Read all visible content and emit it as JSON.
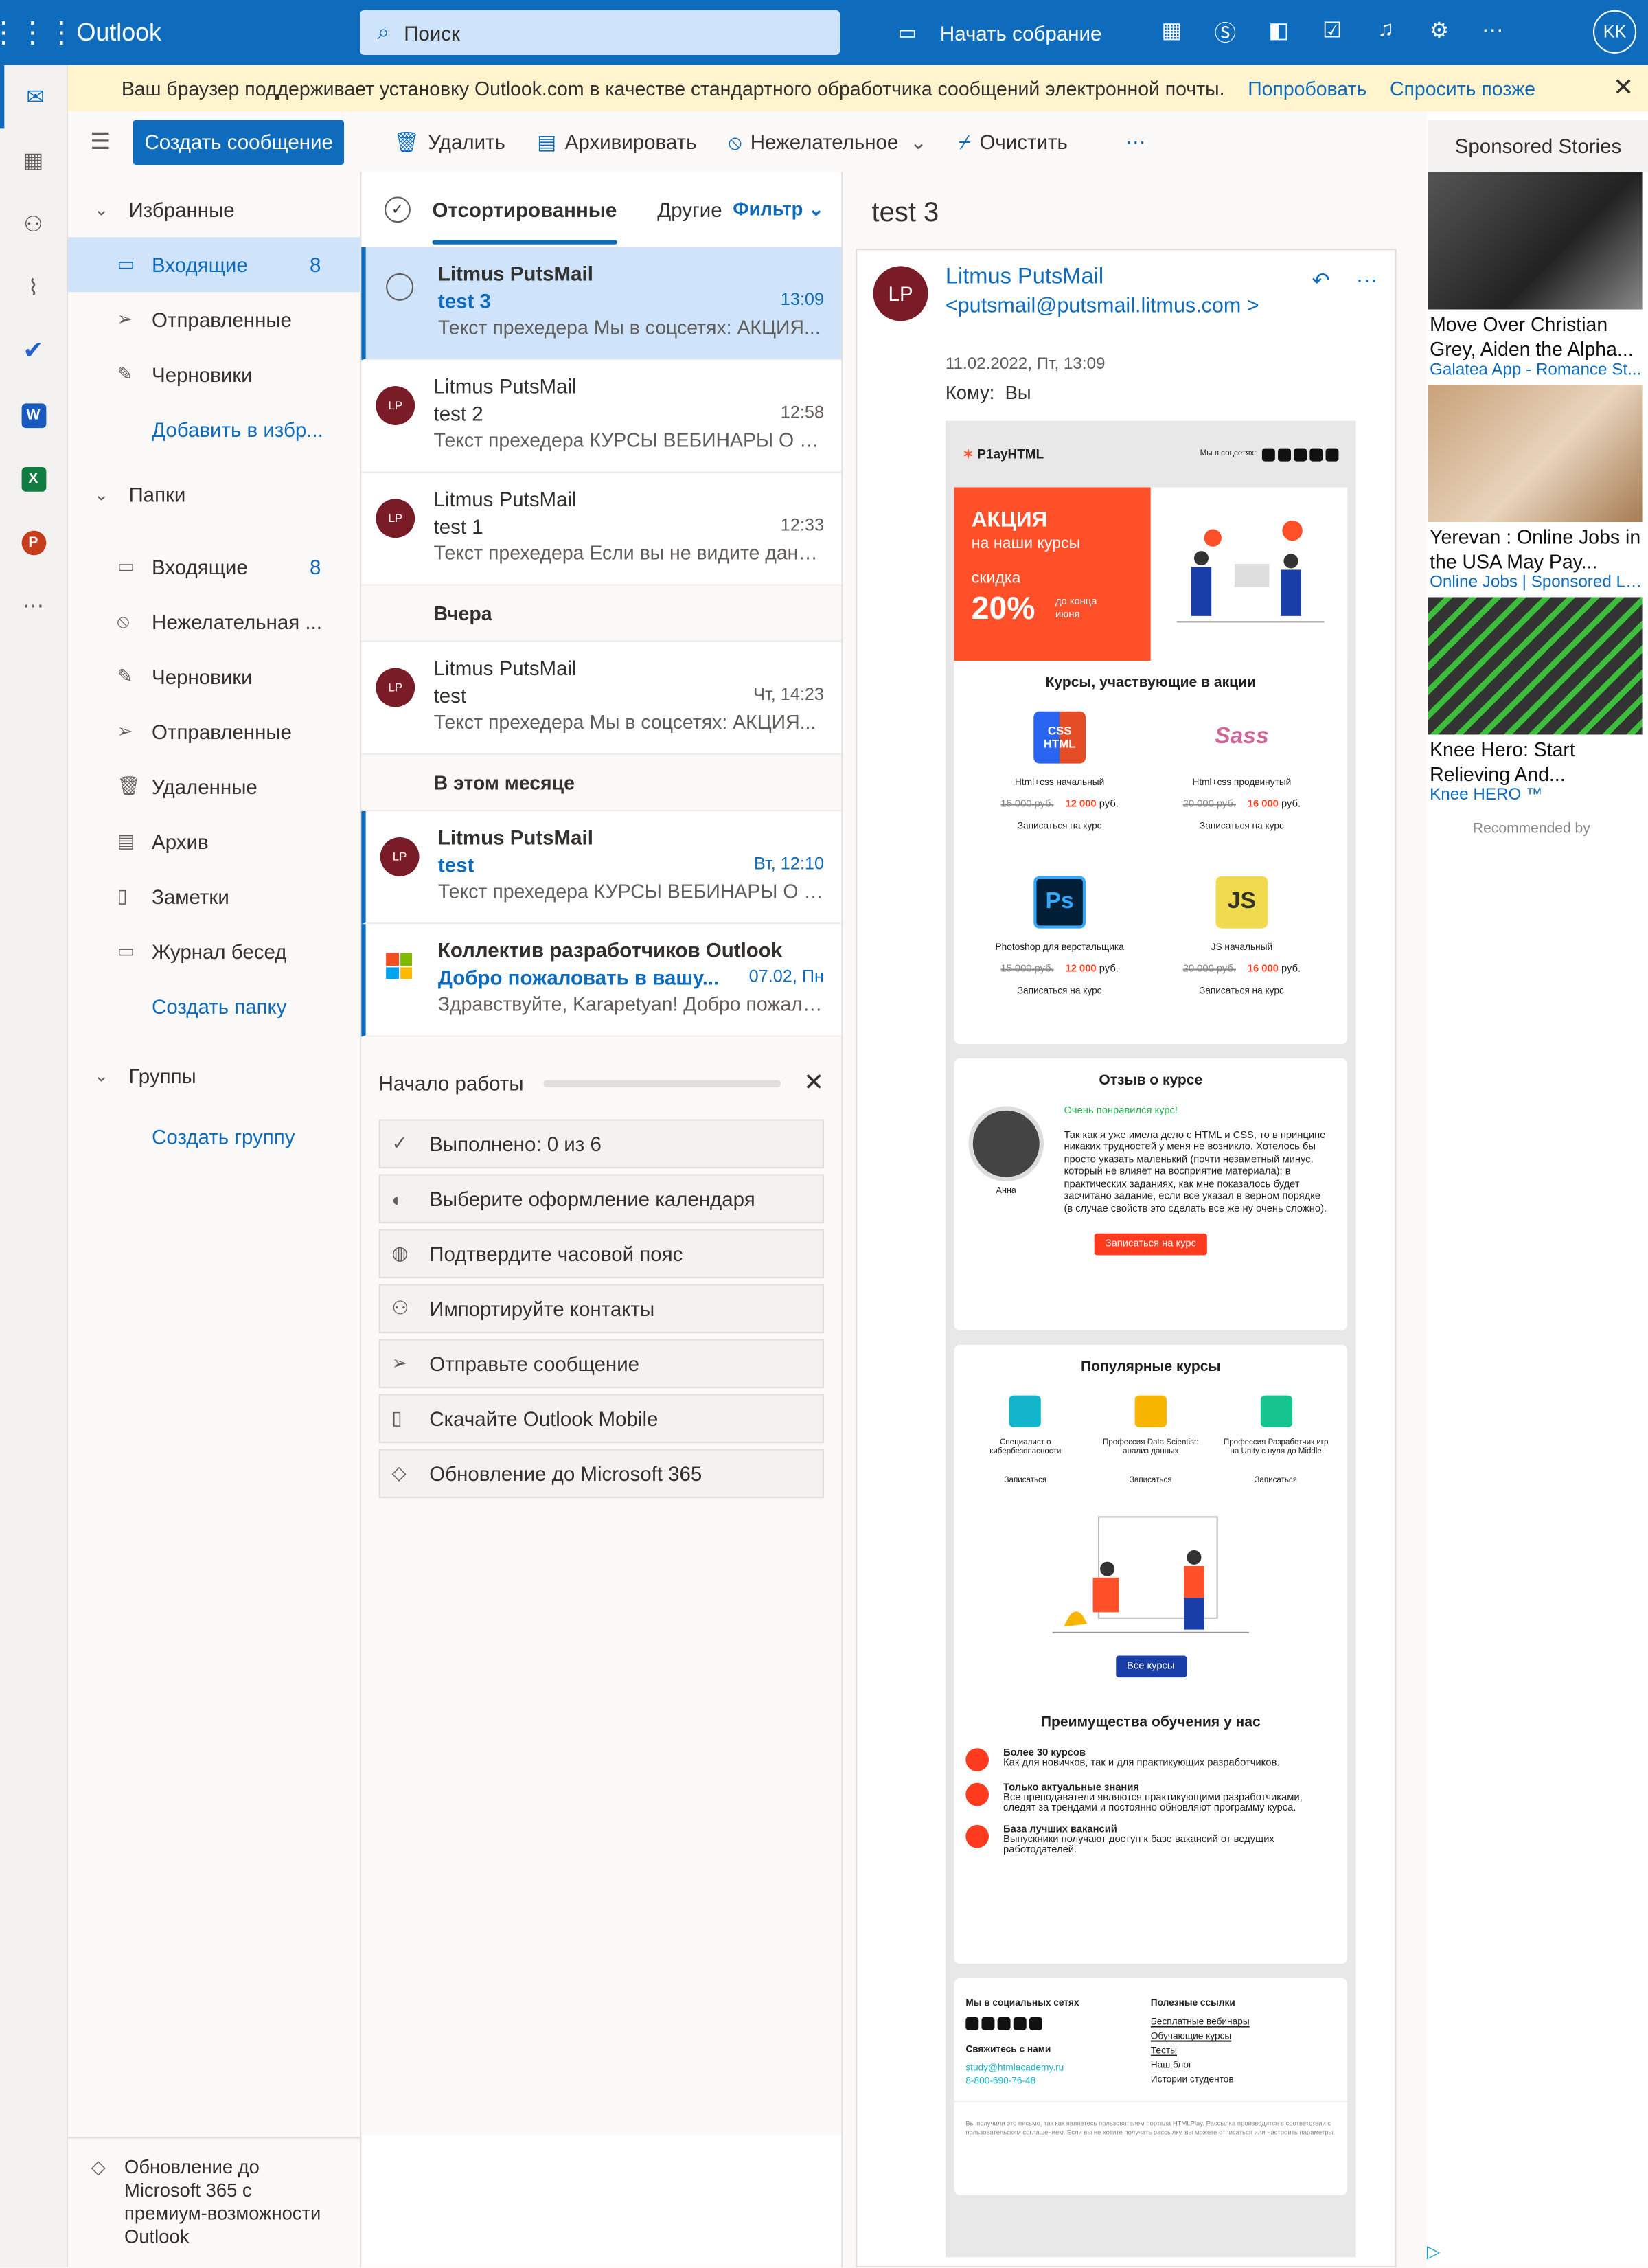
{
  "topbar": {
    "app": "Outlook",
    "search_placeholder": "Поиск",
    "meet": "Начать собрание",
    "user_initials": "KK"
  },
  "banner": {
    "text": "Ваш браузер поддерживает установку Outlook.com в качестве стандартного обработчика сообщений электронной почты.",
    "try": "Попробовать",
    "later": "Спросить позже"
  },
  "commands": {
    "new": "Создать сообщение",
    "delete": "Удалить",
    "archive": "Архивировать",
    "junk": "Нежелательное",
    "sweep": "Очистить"
  },
  "nav": {
    "favorites": "Избранные",
    "fav_items": [
      {
        "label": "Входящие",
        "count": "8"
      },
      {
        "label": "Отправленные",
        "count": ""
      },
      {
        "label": "Черновики",
        "count": ""
      }
    ],
    "add_fav": "Добавить в избр...",
    "folders": "Папки",
    "folder_items": [
      {
        "label": "Входящие",
        "count": "8"
      },
      {
        "label": "Нежелательная ...",
        "count": ""
      },
      {
        "label": "Черновики",
        "count": ""
      },
      {
        "label": "Отправленные",
        "count": ""
      },
      {
        "label": "Удаленные",
        "count": ""
      },
      {
        "label": "Архив",
        "count": ""
      },
      {
        "label": "Заметки",
        "count": ""
      },
      {
        "label": "Журнал бесед",
        "count": ""
      }
    ],
    "create_folder": "Создать папку",
    "groups": "Группы",
    "create_group": "Создать группу",
    "upgrade": "Обновление до Microsoft 365 с премиум-возможности Outlook"
  },
  "list": {
    "tabs": [
      "Отсортированные",
      "Другие"
    ],
    "filter": "Фильтр",
    "messages": [
      {
        "from": "Litmus PutsMail",
        "subject": "test 3",
        "time": "13:09",
        "preview": "Текст прехедера Мы в соцсетях: АКЦИЯ..."
      },
      {
        "from": "Litmus PutsMail",
        "subject": "test 2",
        "time": "12:58",
        "preview": "Текст прехедера КУРСЫ ВЕБИНАРЫ О ШКОЛЕ..."
      },
      {
        "from": "Litmus PutsMail",
        "subject": "test 1",
        "time": "12:33",
        "preview": "Текст прехедера Если вы не видите данное..."
      }
    ],
    "group_yesterday": "Вчера",
    "msg_yesterday": {
      "from": "Litmus PutsMail",
      "subject": "test",
      "time": "Чт, 14:23",
      "preview": "Текст прехедера Мы в соцсетях: АКЦИЯ..."
    },
    "group_month": "В этом месяце",
    "msg_month": [
      {
        "from": "Litmus PutsMail",
        "subject": "test",
        "time": "Вт, 12:10",
        "preview": "Текст прехедера КУРСЫ ВЕБИНАРЫ О ШКОЛЕ..."
      },
      {
        "from": "Коллектив разработчиков Outlook",
        "subject": "Добро пожаловать в вашу...",
        "time": "07.02, Пн",
        "preview": "Здравствуйте, Karapetyan! Добро пожаловать..."
      }
    ],
    "avatar_initials": "LP"
  },
  "start": {
    "title": "Начало работы",
    "tasks": [
      "Выполнено: 0 из 6",
      "Выберите оформление календаря",
      "Подтвердите часовой пояс",
      "Импортируйте контакты",
      "Отправьте сообщение",
      "Скачайте Outlook Mobile",
      "Обновление до Microsoft 365"
    ]
  },
  "reading": {
    "subject": "test 3",
    "sender_name": "Litmus PutsMail",
    "sender_email": "<putsmail@putsmail.litmus.com >",
    "date": "11.02.2022, Пт, 13:09",
    "to_label": "Кому:",
    "to": "Вы",
    "initials": "LP"
  },
  "email": {
    "brand": "P1ayHTML",
    "social_label": "Мы в соцсетях:",
    "promo_a": "АКЦИЯ",
    "promo_b": "на наши курсы",
    "promo_c": "скидка",
    "promo_d": "20%",
    "promo_e": "до конца июня",
    "courses_title": "Курсы, участвующие в акции",
    "courses": [
      {
        "icon": "CSS HTML",
        "name": "Html+css начальный",
        "old": "15 000 руб.",
        "new": "12 000",
        "cur": "руб.",
        "cta": "Записаться на курс",
        "color": "#2965f1"
      },
      {
        "icon": "Sass",
        "name": "Html+css продвинутый",
        "old": "20 000 руб.",
        "new": "16 000",
        "cur": "руб.",
        "cta": "Записаться на курс",
        "color": "#cd6799"
      },
      {
        "icon": "Ps",
        "name": "Photoshop для верстальщика",
        "old": "15 000 руб.",
        "new": "12 000",
        "cur": "руб.",
        "cta": "Записаться на курс",
        "color": "#001e36"
      },
      {
        "icon": "JS",
        "name": "JS начальный",
        "old": "20 000 руб.",
        "new": "16 000",
        "cur": "руб.",
        "cta": "Записаться на курс",
        "color": "#f0db4f"
      }
    ],
    "review_title": "Отзыв о курсе",
    "review_name": "Анна",
    "review_liked": "Очень понравился курс!",
    "review_text": "Так как я уже имела дело с HTML и CSS, то в принципе никаких трудностей у меня не возникло. Хотелось бы просто указать маленький (почти незаметный минус, который не влияет на восприятие материала): в практических заданиях, как мне показалось будет засчитано задание, если все указал в верном порядке (в случае свойств это сделать все же ну очень сложно).",
    "review_cta": "Записаться на курс",
    "popular_title": "Популярные курсы",
    "popular": [
      {
        "name": "Специалист о кибербезопасности",
        "cta": "Записаться"
      },
      {
        "name": "Профессия Data Scientist: анализ данных",
        "cta": "Записаться"
      },
      {
        "name": "Профессия Разработчик игр на Unity с нуля до Middle",
        "cta": "Записаться"
      }
    ],
    "all_courses": "Все курсы",
    "adv_title": "Преимущества обучения у нас",
    "adv": [
      {
        "t": "Более 30 курсов",
        "d": "Как для новичков, так и для практикующих разработчиков."
      },
      {
        "t": "Только актуальные знания",
        "d": "Все преподаватели являются практикующими разработчиками, следят за трендами и постоянно обновляют программу курса."
      },
      {
        "t": "База лучших вакансий",
        "d": "Выпускники получают доступ к базе вакансий от ведущих работодателей."
      }
    ],
    "footer_social": "Мы в социальных сетях",
    "footer_contact": "Свяжитесь с нами",
    "footer_email": "study@htmlacademy.ru",
    "footer_phone": "8-800-690-76-48",
    "footer_links_title": "Полезные ссылки",
    "footer_links": [
      "Бесплатные вебинары",
      "Обучающие курсы",
      "Тесты",
      "Наш блог",
      "Истории студентов"
    ],
    "footer_small": "Вы получили это письмо, так как являетесь пользователем портала HTMLPlay. Рассылка производится в соответствии с пользовательским соглашением. Если вы не хотите получать рассылку, вы можете отписаться или настроить параметры."
  },
  "ads": {
    "title": "Sponsored Stories",
    "items": [
      {
        "caption": "Move Over Christian Grey, Aiden the Alpha...",
        "source": "Galatea App - Romance St..."
      },
      {
        "caption": "Yerevan : Online Jobs in the USA May Pay...",
        "source": "Online Jobs | Sponsored Li..."
      },
      {
        "caption": "Knee Hero: Start Relieving And...",
        "source": "Knee HERO ™"
      }
    ],
    "recommended": "Recommended by"
  }
}
